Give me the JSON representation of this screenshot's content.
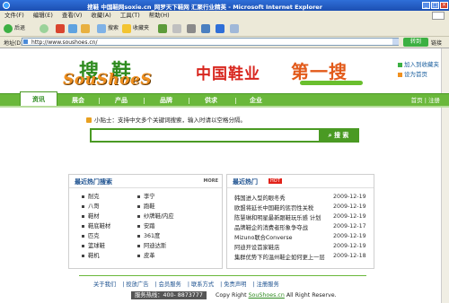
{
  "window": {
    "title": "搜鞋 中国鞋网soxie.cn_网罗天下鞋网  汇聚行业精英 - Microsoft Internet Explorer"
  },
  "menu": [
    "文件(F)",
    "编辑(E)",
    "查看(V)",
    "收藏(A)",
    "工具(T)",
    "帮助(H)"
  ],
  "toolbar": {
    "back": "后退",
    "search": "搜索",
    "favorites": "收藏夹"
  },
  "address": {
    "label": "地址(D)",
    "url": "http://www.soushoes.cn/",
    "go": "转到",
    "links": "链接"
  },
  "header": {
    "logo_cn_1": "搜",
    "logo_cn_2": "鞋",
    "logo_en": "SouShoeS",
    "banner_left": "中国鞋业",
    "banner_right": "第一搜",
    "link_add_favorite": "加入到收藏夹",
    "link_set_home": "设为首页"
  },
  "nav": {
    "items": [
      "资讯",
      "展会",
      "产品",
      "品牌",
      "供求",
      "企业"
    ],
    "right": [
      "首页",
      "注册"
    ]
  },
  "search": {
    "tip": "小贴士：支持中文多个关键词搜索，输入时请以空格分隔。",
    "value": "",
    "button": "搜 索"
  },
  "hot_search": {
    "title": "最近热门搜索",
    "more": "MORE",
    "col1": [
      "耐克",
      "八哥",
      "鞋材",
      "鞋底鞋材",
      "匹克",
      "篮球鞋",
      "鞋机"
    ],
    "col2": [
      "李宁",
      "跑鞋",
      "纱牌鞋/内应",
      "安踏",
      "361度",
      "阿迪达斯",
      "皮革"
    ]
  },
  "hot_news": {
    "title": "最近热门",
    "hot_badge": "HOT",
    "items": [
      {
        "title": "韩国进入型的眼冬秀",
        "date": "2009-12-19"
      },
      {
        "title": "欧盟将延长中国鞋的惩罚性关税",
        "date": "2009-12-19"
      },
      {
        "title": "陈慧琳和明星最新跟鞋玩乐感 计划",
        "date": "2009-12-19"
      },
      {
        "title": "品牌鞋企的消费者形象争夺战",
        "date": "2009-12-17"
      },
      {
        "title": "Mizuno联合Converse",
        "date": "2009-12-19"
      },
      {
        "title": "阿迪开设首家鞋店",
        "date": "2009-12-19"
      },
      {
        "title": "集群优势下的温州鞋企如何更上一层",
        "date": "2009-12-18"
      }
    ]
  },
  "footer": {
    "links": [
      "关于我们",
      "投放广告",
      "会员服务",
      "联系方式",
      "免责声明",
      "注册服务"
    ],
    "hotline": "服务热线：400- 8873777",
    "copyright_prefix": "Copy Right ",
    "copyright_link": "SouShoes.cn",
    "copyright_suffix": " All Right Reserve."
  },
  "colors": {
    "brand_green": "#6ab83b",
    "dark_green": "#2e8b1f",
    "logo_orange": "#f09020",
    "banner_red": "#d8261e"
  }
}
